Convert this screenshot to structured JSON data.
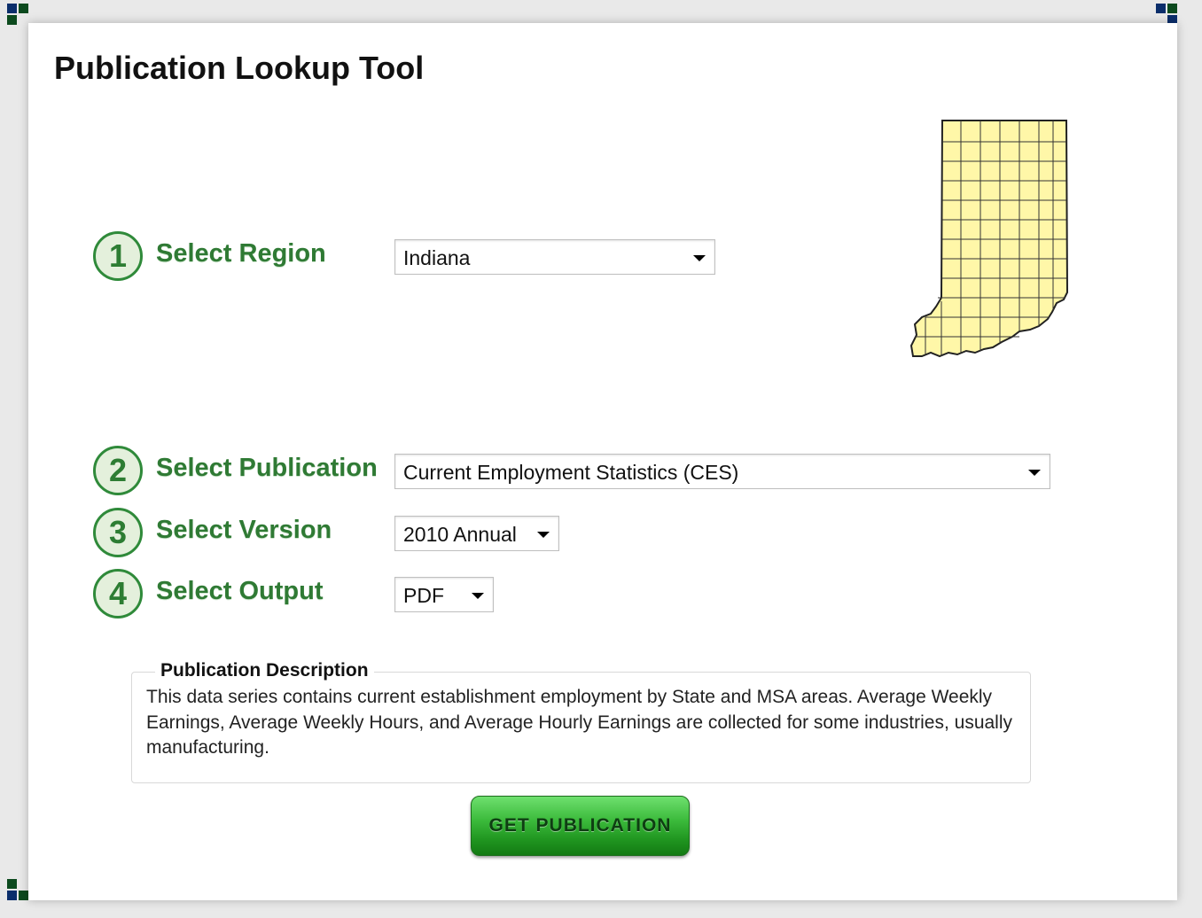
{
  "page": {
    "title": "Publication Lookup Tool"
  },
  "steps": [
    {
      "number": "1",
      "label": "Select Region",
      "selected": "Indiana"
    },
    {
      "number": "2",
      "label": "Select Publication",
      "selected": "Current Employment Statistics (CES)"
    },
    {
      "number": "3",
      "label": "Select Version",
      "selected": "2010 Annual"
    },
    {
      "number": "4",
      "label": "Select Output",
      "selected": "PDF"
    }
  ],
  "description": {
    "legend": "Publication Description",
    "text": "This data series contains current establishment employment by State and MSA areas. Average Weekly Earnings, Average Weekly Hours, and Average Hourly Earnings are collected for some industries, usually manufacturing."
  },
  "actions": {
    "get_publication_label": "GET PUBLICATION"
  },
  "icons": {
    "region_map": "indiana-county-map-icon",
    "dropdown": "dropdown-arrow-icon"
  },
  "colors": {
    "step_green": "#2f7a34",
    "button_green": "#3cbb3c",
    "map_fill": "#fff7a8",
    "corner_navy": "#0b2e6b",
    "corner_green": "#0c4a1e"
  }
}
